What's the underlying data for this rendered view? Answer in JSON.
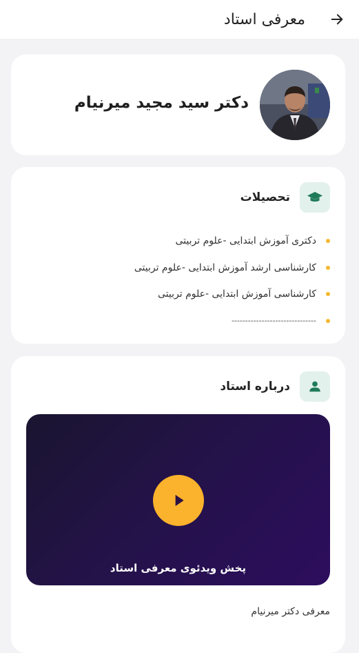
{
  "header": {
    "title": "معرفی استاد",
    "back_icon": "arrow-right-icon"
  },
  "profile": {
    "name": "دکتر سید مجید میرنیام",
    "avatar_icon": "avatar-photo"
  },
  "education": {
    "title": "تحصیلات",
    "icon": "graduation-cap-icon",
    "items": [
      "دکتری آموزش ابتدایی -علوم تربیتی",
      "کارشناسی ارشد آموزش ابتدایی -علوم تربیتی",
      "کارشناسی آموزش ابتدایی -علوم تربیتی",
      "-------------------------------"
    ]
  },
  "about": {
    "title": "درباره استاد",
    "icon": "person-icon",
    "video_label": "پخش ویدئوی معرفی استاد",
    "play_icon": "play-icon",
    "description": "معرفی دکتر میرنیام"
  },
  "colors": {
    "accent": "#fbb22c",
    "icon_bg": "#e3f1ec",
    "icon_fg": "#1f7a5a",
    "video_start": "#1a1530",
    "video_end": "#2d0d5e"
  }
}
